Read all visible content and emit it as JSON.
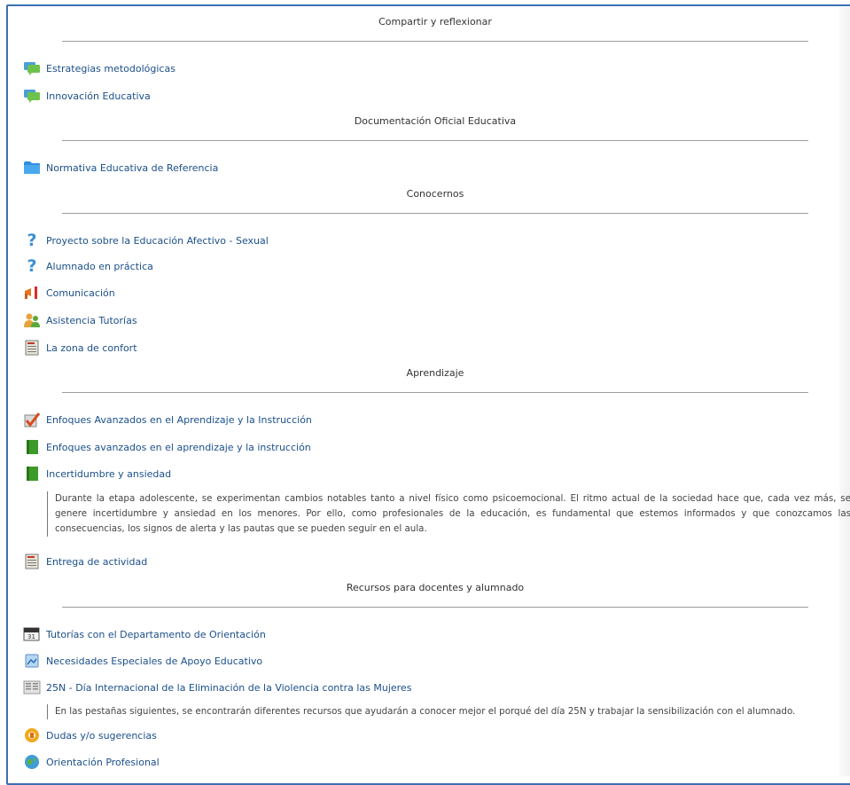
{
  "sections": [
    {
      "title": "Compartir y reflexionar",
      "items": [
        {
          "icon": "forum-icon",
          "label": "Estrategias metodológicas"
        },
        {
          "icon": "forum-icon",
          "label": "Innovación Educativa"
        }
      ]
    },
    {
      "title": "Documentación Oficial Educativa",
      "items": [
        {
          "icon": "folder-icon",
          "label": "Normativa Educativa de Referencia"
        }
      ]
    },
    {
      "title": "Conocernos",
      "items": [
        {
          "icon": "question-icon",
          "label": "Proyecto sobre la Educación Afectivo - Sexual"
        },
        {
          "icon": "question-icon",
          "label": "Alumnado en práctica"
        },
        {
          "icon": "megaphone-icon",
          "label": "Comunicación"
        },
        {
          "icon": "group-icon",
          "label": "Asistencia Tutorías"
        },
        {
          "icon": "assignment-icon",
          "label": "La zona de confort"
        }
      ]
    },
    {
      "title": "Aprendizaje",
      "items": [
        {
          "icon": "checkmark-icon",
          "label": "Enfoques Avanzados en el Aprendizaje y la Instrucción"
        },
        {
          "icon": "book-icon",
          "label": "Enfoques avanzados en el aprendizaje y la instrucción"
        },
        {
          "icon": "book-icon",
          "label": "Incertidumbre y ansiedad"
        },
        {
          "icon": "assignment-icon",
          "label": "Entrega de actividad"
        }
      ],
      "description": "Durante la etapa adolescente, se experimentan cambios notables tanto a nivel físico como psicoemocional. El ritmo actual de la sociedad hace que, cada vez más, se genere incertidumbre y ansiedad en los menores. Por ello, como profesionales de la educación, es fundamental que estemos informados y que conozcamos las consecuencias, los signos de alerta y las pautas que se pueden seguir en el aula."
    },
    {
      "title": "Recursos para docentes y alumnado",
      "items": [
        {
          "icon": "calendar-icon",
          "label": "Tutorías con el Departamento de Orientación"
        },
        {
          "icon": "file-icon",
          "label": "Necesidades Especiales de Apoyo Educativo"
        },
        {
          "icon": "glossary-icon",
          "label": "25N - Día Internacional de la Eliminación de la Violencia contra las Mujeres"
        },
        {
          "icon": "survey-icon",
          "label": "Dudas y/o sugerencias"
        },
        {
          "icon": "globe-icon",
          "label": "Orientación Profesional"
        }
      ],
      "description": "En las pestañas siguientes, se encontrarán diferentes recursos que ayudarán a conocer mejor el porqué del día 25N y trabajar la sensibilización con el alumnado."
    }
  ]
}
